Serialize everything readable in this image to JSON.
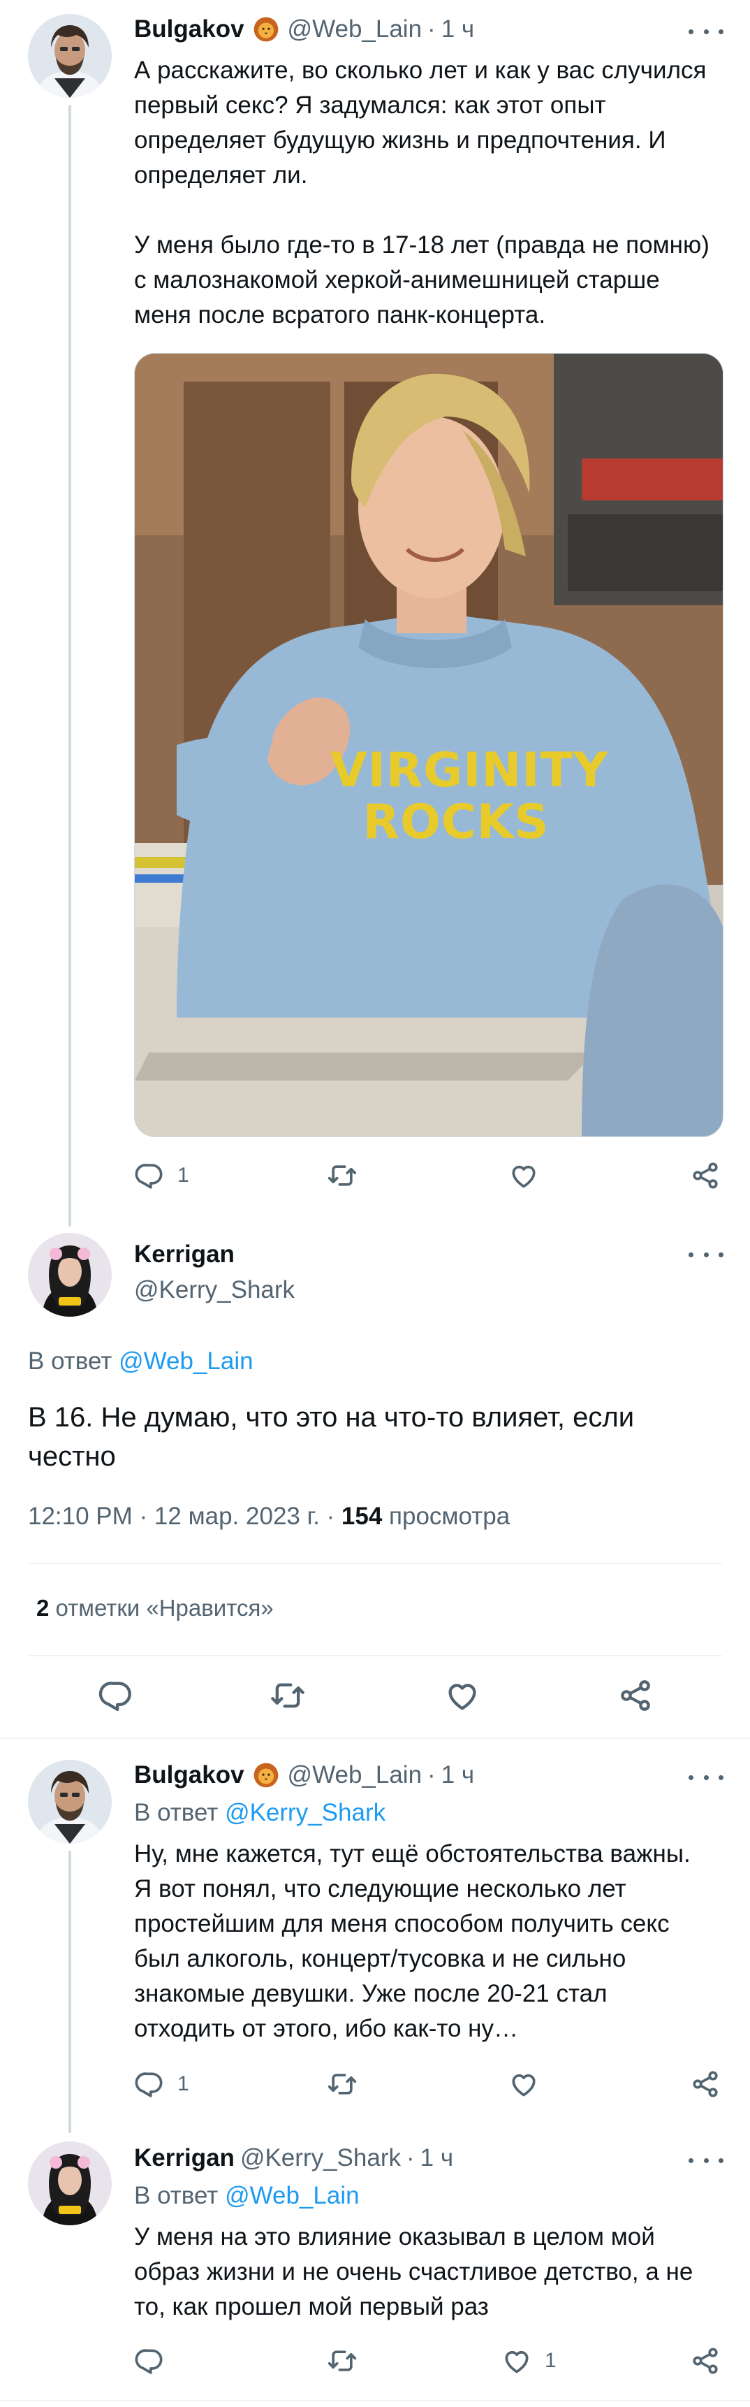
{
  "colors": {
    "accent": "#1d9bf0",
    "text": "#0f1419",
    "muted": "#536471",
    "line": "#cfd9de"
  },
  "tweet1": {
    "name": "Bulgakov",
    "handle": "@Web_Lain",
    "sep": "·",
    "time": "1 ч",
    "emoji": "lion-face",
    "text": "А расскажите, во сколько лет и как у вас случился первый секс? Я задумался: как этот опыт определяет будущую жизнь и предпочтения. И определяет ли.\n\nУ меня было где-то в 17-18 лет (правда не помню) с малознакомой херкой-анимешницей старше меня после всратого панк-концерта.",
    "image_text_1": "VIRGINITY",
    "image_text_2": "ROCKS",
    "reply_count": "1"
  },
  "main": {
    "name": "Kerrigan",
    "handle": "@Kerry_Shark",
    "reply_to_label": "В ответ ",
    "reply_to_handle": "@Web_Lain",
    "text": "В 16. Не думаю, что это на что-то влияет, если честно",
    "timestamp": "12:10 PM · 12 мар. 2023 г. · ",
    "views_count": "154",
    "views_label": " просмотра",
    "likes_count": "2",
    "likes_label": " отметки «Нравится»"
  },
  "tweet3": {
    "name": "Bulgakov",
    "handle": "@Web_Lain",
    "sep": "·",
    "time": "1 ч",
    "emoji": "lion-face",
    "reply_to_label": "В ответ ",
    "reply_to_handle": "@Kerry_Shark",
    "text": "Ну, мне кажется, тут ещё обстоятельства важны. Я вот понял, что следующие несколько лет простейшим для меня способом получить секс был алкоголь, концерт/тусовка и не сильно знакомые девушки. Уже после 20-21 стал отходить от этого, ибо как-то ну…",
    "reply_count": "1"
  },
  "tweet4": {
    "name": "Kerrigan",
    "handle": "@Kerry_Shark",
    "sep": "·",
    "time": "1 ч",
    "reply_to_label": "В ответ ",
    "reply_to_handle": "@Web_Lain",
    "text": "У меня на это влияние оказывал в целом мой образ жизни и не очень счастливое детство, а не то, как прошел мой первый раз",
    "like_count": "1"
  }
}
